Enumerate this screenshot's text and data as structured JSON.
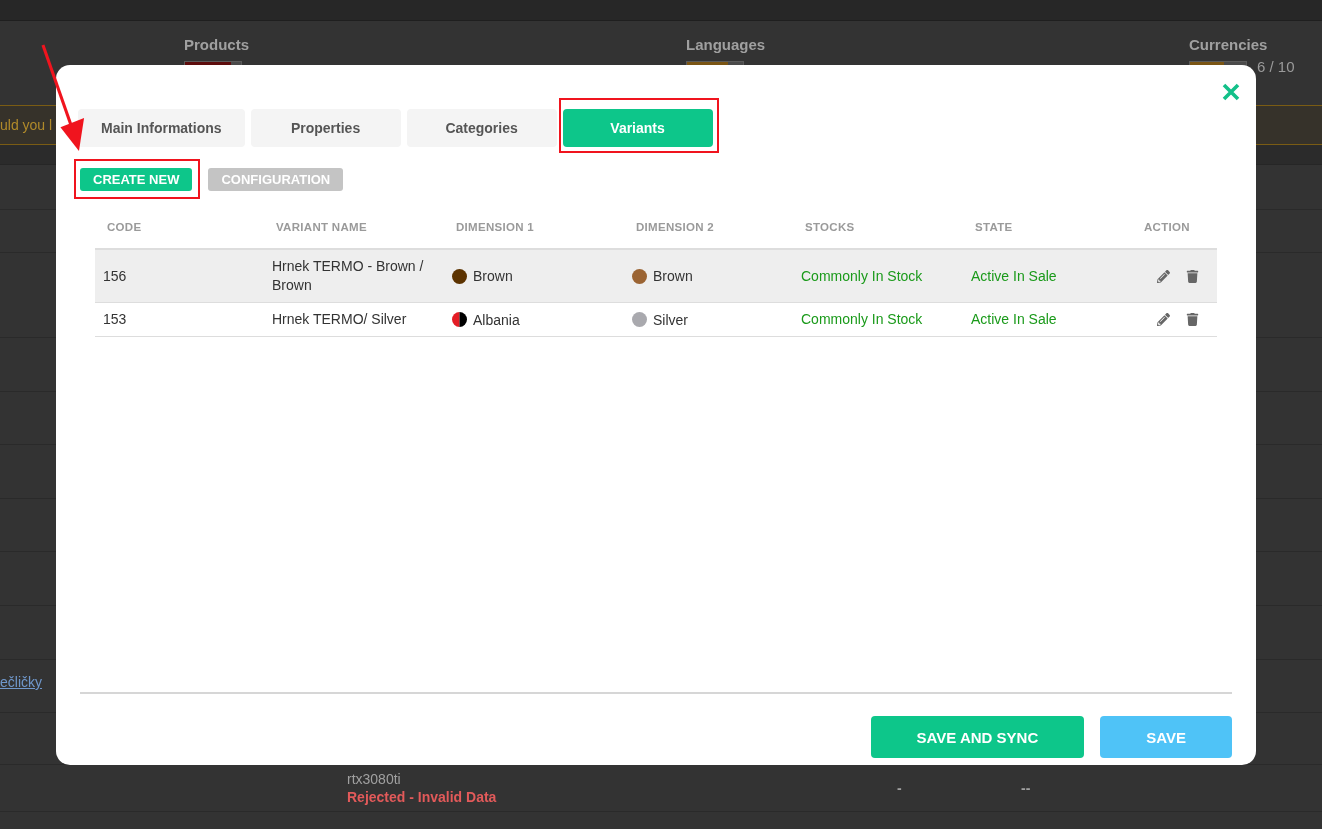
{
  "background_page": {
    "stats": [
      {
        "label": "Products",
        "level": 0.82,
        "color": "#5e0d0d"
      },
      {
        "label": "Languages",
        "level": 0.73,
        "color": "#7a5514"
      },
      {
        "label": "Currencies",
        "level": 0.6,
        "color": "#7a5514",
        "reading": "6 / 10"
      }
    ],
    "notice": {
      "text": "uld you l"
    },
    "link_row": {
      "link": "ečličky"
    },
    "rows": [
      {
        "name": "rtx3080ti",
        "status": "Rejected - Invalid Data",
        "column_3": "-",
        "column_4": "--"
      }
    ]
  },
  "dialog": {
    "tabs": [
      {
        "label": "Main Informations",
        "selected": false,
        "highlighted": false
      },
      {
        "label": "Properties",
        "selected": false,
        "highlighted": false
      },
      {
        "label": "Categories",
        "selected": false,
        "highlighted": false
      },
      {
        "label": "Variants",
        "selected": true,
        "highlighted": true
      }
    ],
    "buttons": [
      {
        "label": "CREATE NEW",
        "kind": "primary",
        "highlighted": true
      },
      {
        "label": "CONFIGURATION",
        "kind": "secondary",
        "highlighted": false
      }
    ],
    "table": {
      "columns": [
        "CODE",
        "VARIANT NAME",
        "DIMENSION 1",
        "DIMENSION 2",
        "STOCKS",
        "STATE",
        "ACTION"
      ],
      "rows": [
        {
          "code": "156",
          "name": "Hrnek TERMO - Brown / Brown",
          "dimension_1": {
            "label": "Brown",
            "swatch": [
              {
                "color": "#5c3300"
              }
            ]
          },
          "dimension_2": {
            "label": "Brown",
            "swatch": [
              {
                "color": "#9b6433"
              }
            ]
          },
          "stock": "Commonly In Stock",
          "stock_ok": true,
          "state": "Active In Sale",
          "state_active": true,
          "hovered": true
        },
        {
          "code": "153",
          "name": "Hrnek TERMO/ Silver",
          "dimension_1": {
            "label": "Albania",
            "swatch": [
              {
                "color": "#e41e26"
              },
              {
                "color": "#000000"
              }
            ]
          },
          "dimension_2": {
            "label": "Silver",
            "swatch": [
              {
                "color": "#a9a9ae"
              }
            ]
          },
          "stock": "Commonly In Stock",
          "stock_ok": true,
          "state": "Active In Sale",
          "state_active": true,
          "hovered": false
        }
      ]
    },
    "footer_buttons": [
      {
        "label": "SAVE AND SYNC",
        "kind": "primary"
      },
      {
        "label": "SAVE",
        "kind": "info"
      }
    ]
  }
}
